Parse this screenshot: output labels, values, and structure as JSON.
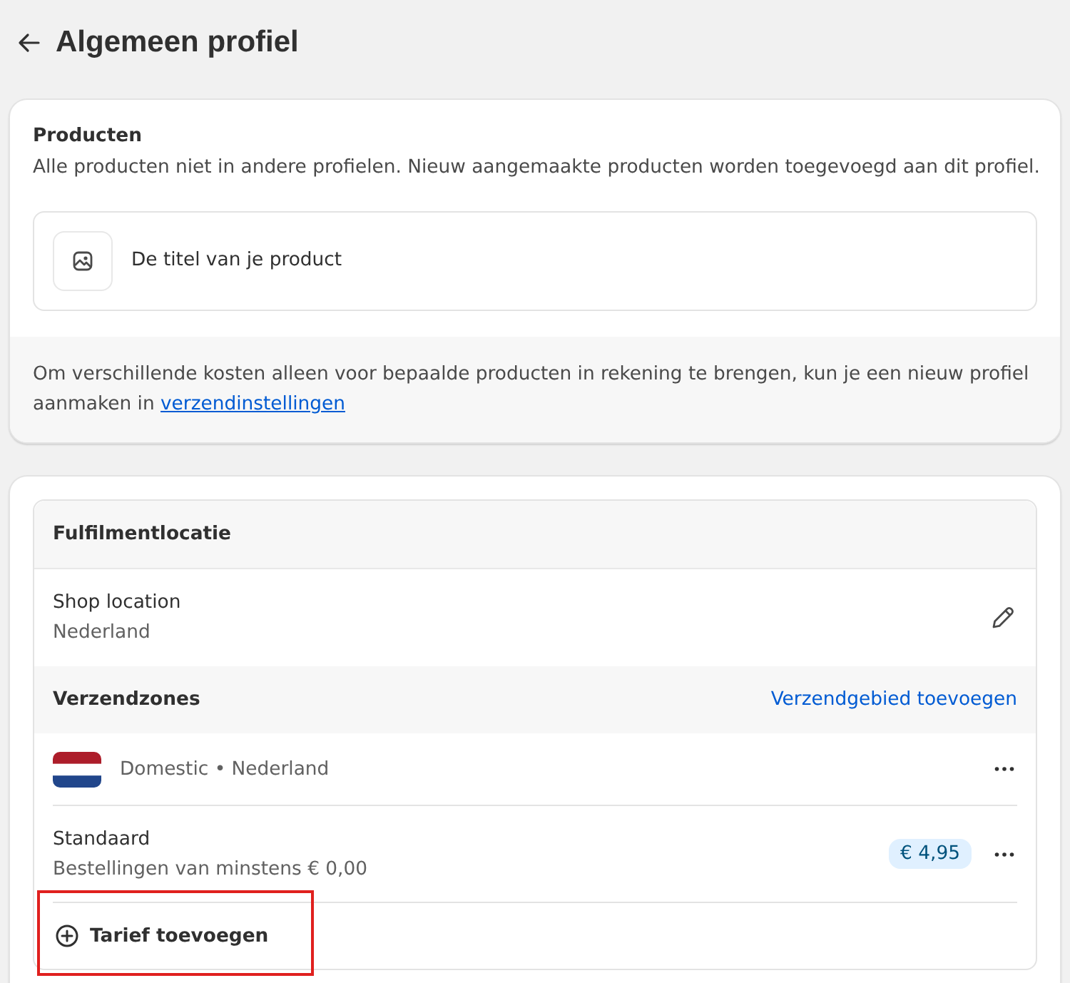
{
  "header": {
    "title": "Algemeen profiel"
  },
  "products_section": {
    "title": "Producten",
    "description": "Alle producten niet in andere profielen. Nieuw aangemaakte producten worden toegevoegd aan dit profiel.",
    "products": [
      {
        "title": "De titel van je product"
      }
    ],
    "note": {
      "text": "Om verschillende kosten alleen voor bepaalde producten in rekening te brengen, kun je een nieuw profiel aanmaken in",
      "link": "verzendinstellingen"
    }
  },
  "fulfillment": {
    "title": "Fulfilmentlocatie",
    "locations": [
      {
        "name": "Shop location",
        "country": "Nederland"
      }
    ]
  },
  "shipping_zones": {
    "title": "Verzendzones",
    "add_link": "Verzendgebied toevoegen",
    "zones": [
      {
        "label": "Domestic • Nederland",
        "rates": [
          {
            "name": "Standaard",
            "condition": "Bestellingen van minstens € 0,00",
            "price": "€ 4,95"
          }
        ],
        "add_rate": {
          "label": "Tarief toevoegen",
          "highlighted": true
        }
      }
    ]
  }
}
